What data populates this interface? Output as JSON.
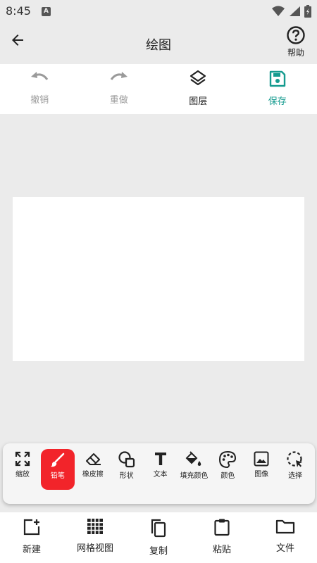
{
  "status": {
    "time": "8:45",
    "notification_icon": "A"
  },
  "app_bar": {
    "title": "绘图",
    "help_label": "帮助"
  },
  "actions": [
    {
      "label": "撤销",
      "icon": "undo-icon",
      "state": "disabled"
    },
    {
      "label": "重做",
      "icon": "redo-icon",
      "state": "disabled"
    },
    {
      "label": "图层",
      "icon": "layers-icon",
      "state": "normal"
    },
    {
      "label": "保存",
      "icon": "save-icon",
      "state": "accent"
    }
  ],
  "tools": [
    {
      "label": "缩放",
      "icon": "zoom-expand-icon"
    },
    {
      "label": "铅笔",
      "icon": "brush-icon",
      "active": true
    },
    {
      "label": "橡皮擦",
      "icon": "eraser-icon"
    },
    {
      "label": "形状",
      "icon": "shapes-icon"
    },
    {
      "label": "文本",
      "icon": "text-icon"
    },
    {
      "label": "填充颜色",
      "icon": "paint-bucket-icon"
    },
    {
      "label": "颜色",
      "icon": "palette-icon"
    },
    {
      "label": "图像",
      "icon": "image-icon"
    },
    {
      "label": "选择",
      "icon": "select-icon"
    }
  ],
  "bottom_nav": [
    {
      "label": "新建",
      "icon": "new-icon"
    },
    {
      "label": "网格视图",
      "icon": "grid-icon"
    },
    {
      "label": "复制",
      "icon": "copy-icon"
    },
    {
      "label": "粘贴",
      "icon": "paste-icon"
    },
    {
      "label": "文件",
      "icon": "folder-icon"
    }
  ],
  "colors": {
    "accent": "#159b8f",
    "active_tool": "#f2242a",
    "background": "#ebebeb",
    "disabled": "#9a9a9a"
  }
}
